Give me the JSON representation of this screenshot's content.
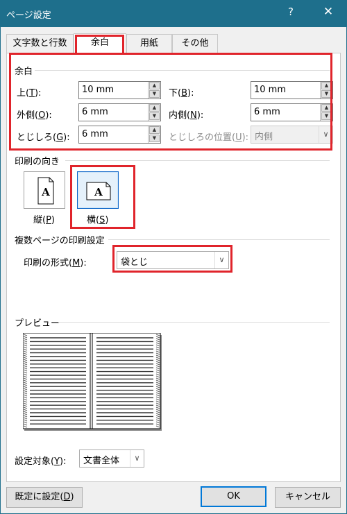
{
  "window": {
    "title": "ページ設定",
    "help_glyph": "?",
    "close_glyph": "✕"
  },
  "tabs": [
    {
      "label": "文字数と行数"
    },
    {
      "label": "余白"
    },
    {
      "label": "用紙"
    },
    {
      "label": "その他"
    }
  ],
  "margins": {
    "section_title": "余白",
    "top": {
      "label": "上(",
      "key": "T",
      "suffix": "):",
      "value": "10 mm"
    },
    "bottom": {
      "label": "下(",
      "key": "B",
      "suffix": "):",
      "value": "10 mm"
    },
    "outside": {
      "label": "外側(",
      "key": "O",
      "suffix": "):",
      "value": "6 mm"
    },
    "inside": {
      "label": "内側(",
      "key": "N",
      "suffix": "):",
      "value": "6 mm"
    },
    "gutter": {
      "label": "とじしろ(",
      "key": "G",
      "suffix": "):",
      "value": "6 mm"
    },
    "gutter_pos": {
      "label": "とじしろの位置(",
      "key": "U",
      "suffix": "):",
      "value": "内側"
    }
  },
  "orientation": {
    "section_title": "印刷の向き",
    "portrait": {
      "label": "縦(",
      "key": "P",
      "suffix": ")"
    },
    "landscape": {
      "label": "横(",
      "key": "S",
      "suffix": ")"
    },
    "selected": "landscape"
  },
  "pages": {
    "section_title": "複数ページの印刷設定",
    "format_label": "印刷の形式(",
    "format_key": "M",
    "format_suffix": "):",
    "format_value": "袋とじ"
  },
  "preview": {
    "section_title": "プレビュー"
  },
  "apply_to": {
    "label": "設定対象(",
    "key": "Y",
    "suffix": "):",
    "value": "文書全体"
  },
  "buttons": {
    "default_label": "既定に設定(",
    "default_key": "D",
    "default_suffix": ")",
    "ok": "OK",
    "cancel": "キャンセル"
  },
  "colors": {
    "titlebar": "#1e6f8c",
    "highlight": "#e0242b"
  }
}
